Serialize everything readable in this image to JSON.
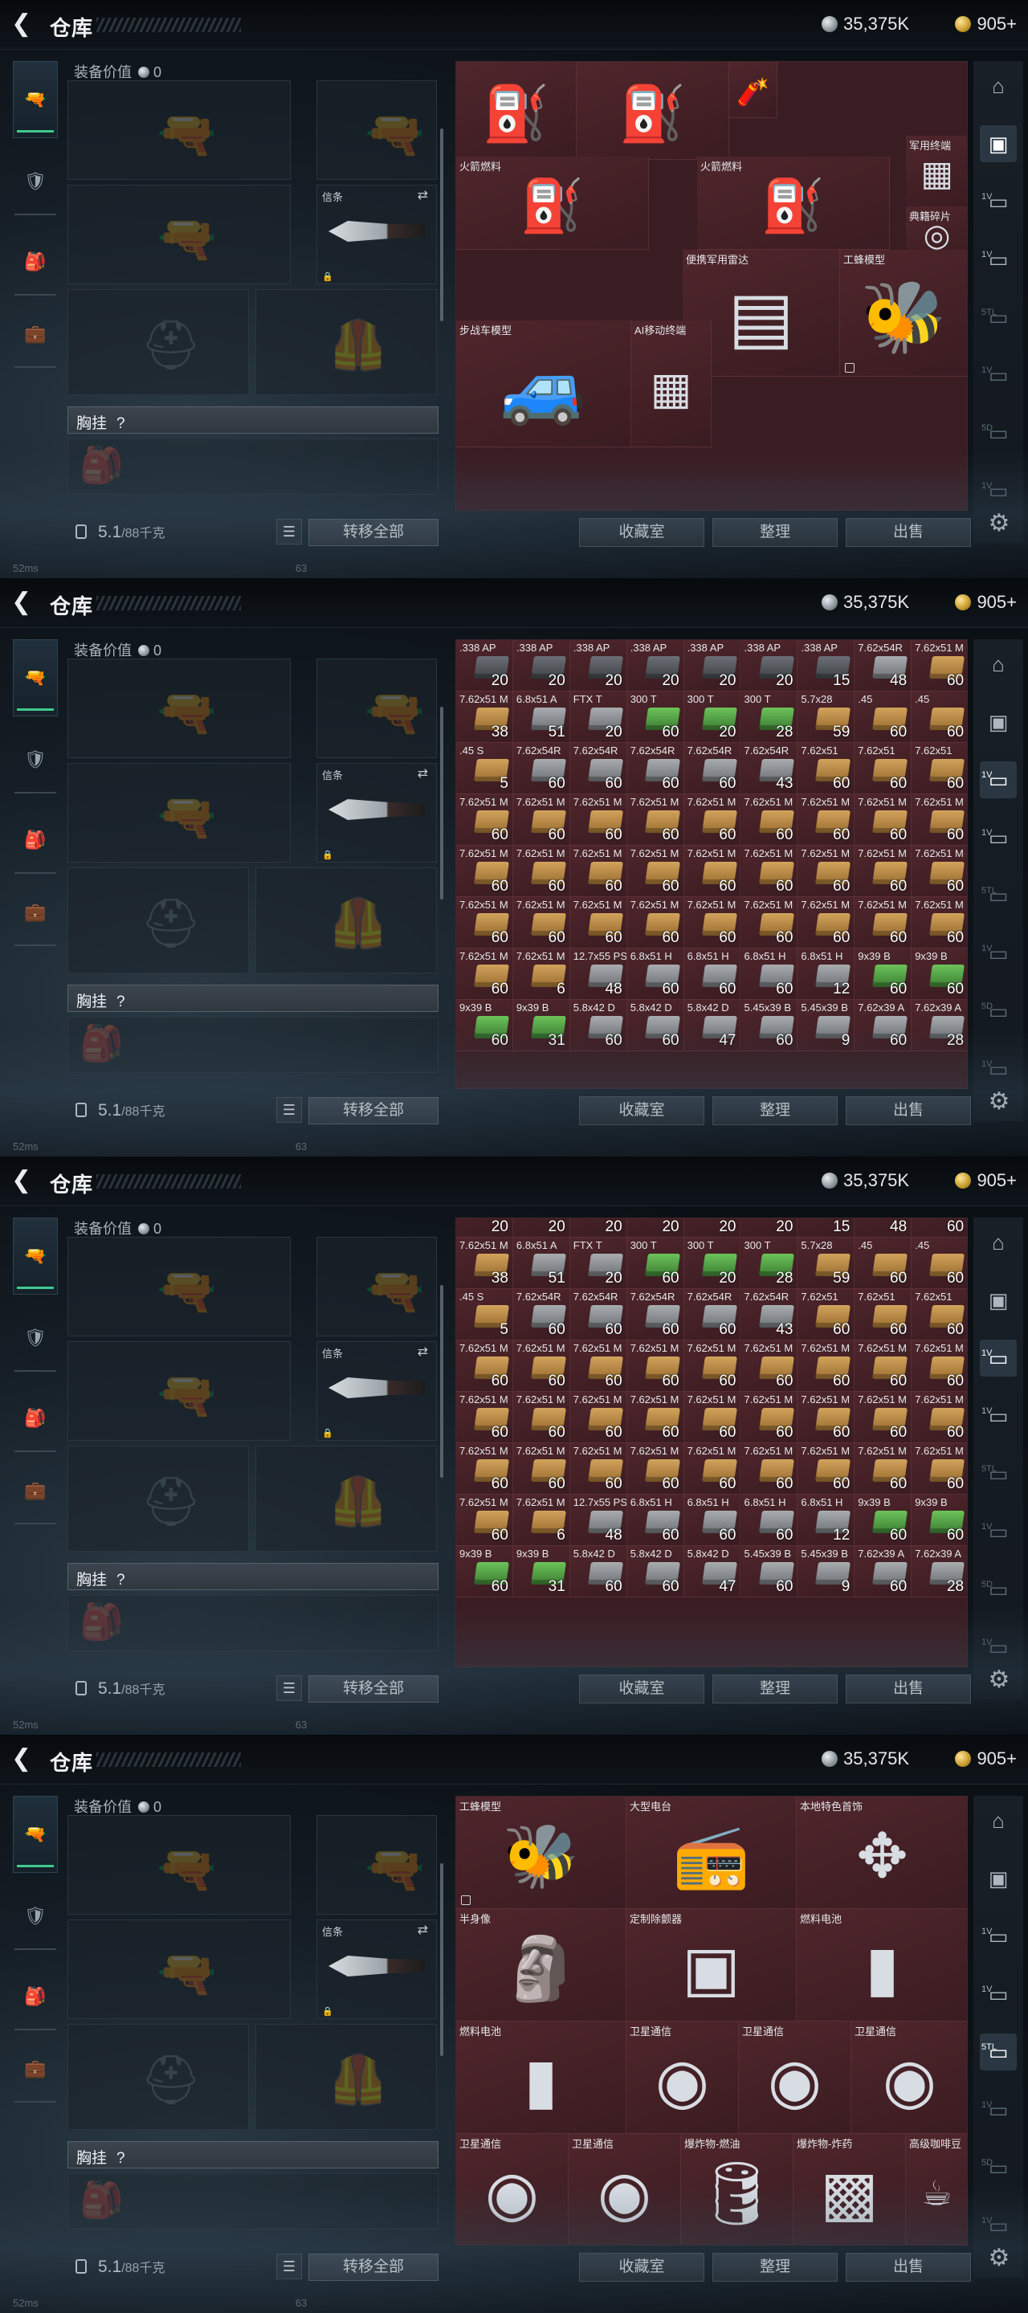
{
  "app": {
    "title": "仓库",
    "back_icon": "back-arrow-icon",
    "currency": [
      {
        "icon": "silver-coin-icon",
        "value": "35,375K"
      },
      {
        "icon": "gold-coin-icon",
        "value": "905+"
      }
    ]
  },
  "left_nav": [
    {
      "icon": "pistol-icon",
      "active": true
    },
    {
      "icon": "armor-vest-icon",
      "active": false
    },
    {
      "icon": "backpack-icon",
      "active": false
    },
    {
      "icon": "briefcase-icon",
      "active": false
    }
  ],
  "equipment": {
    "label": "装备价值",
    "value": "0",
    "melee_label": "信条",
    "chest_label": "胸挂",
    "chest_help": "?",
    "weight": "5.1",
    "weight_max": "/88千克",
    "transfer_all": "转移全部"
  },
  "actions": [
    "收藏室",
    "整理",
    "出售"
  ],
  "status": {
    "wifi": "52ms",
    "num": "63"
  },
  "right_rail": [
    {
      "icon": "vault-icon",
      "label": ""
    },
    {
      "icon": "wallet-icon",
      "label": ""
    },
    {
      "icon": "shelf-icon",
      "label": "1V"
    },
    {
      "icon": "shelf-icon",
      "label": "1V"
    },
    {
      "icon": "shelf-icon",
      "label": "5TL"
    },
    {
      "icon": "shelf-icon",
      "label": "1V"
    },
    {
      "icon": "shelf-icon",
      "label": "5D"
    },
    {
      "icon": "shelf-icon",
      "label": "1V"
    }
  ],
  "frames": [
    {
      "rail_selected": 1,
      "items": [
        {
          "name": "",
          "count": "",
          "icon": "oxygen-tank-icon"
        },
        {
          "name": "",
          "count": "",
          "icon": "oxygen-tank-icon"
        },
        {
          "name": "",
          "count": "",
          "icon": "flare-icon"
        },
        {
          "name": "火箭燃料",
          "count": "",
          "icon": "jerrycan-icon"
        },
        {
          "name": "军用终端",
          "count": "",
          "icon": "circuit-board-icon"
        },
        {
          "name": "火箭燃料",
          "count": "",
          "icon": "jerrycan-icon"
        },
        {
          "name": "典籍碎片",
          "count": "",
          "icon": "medal-icon"
        },
        {
          "name": "便携军用雷达",
          "count": "",
          "icon": "radar-icon"
        },
        {
          "name": "工蜂模型",
          "count": "",
          "icon": "bee-model-icon"
        },
        {
          "name": "步战车模型",
          "count": "",
          "icon": "ifv-model-icon"
        },
        {
          "name": "AI移动终端",
          "count": "",
          "icon": "circuit-board-icon"
        }
      ]
    },
    {
      "rail_selected": 2,
      "ammo_rows": [
        [
          [
            ".338 AP",
            "20",
            "dark"
          ],
          [
            ".338 AP",
            "20",
            "dark"
          ],
          [
            ".338 AP",
            "20",
            "dark"
          ],
          [
            ".338 AP",
            "20",
            "dark"
          ],
          [
            ".338 AP",
            "20",
            "dark"
          ],
          [
            ".338 AP",
            "20",
            "dark"
          ],
          [
            ".338 AP",
            "15",
            "dark"
          ],
          [
            "7.62x54R",
            "48",
            "grey"
          ],
          [
            "7.62x51 M",
            "60",
            "tan"
          ]
        ],
        [
          [
            "7.62x51 M",
            "38",
            "tan"
          ],
          [
            "6.8x51 A",
            "51",
            "grey"
          ],
          [
            "FTX T",
            "20",
            "grey"
          ],
          [
            "300 T",
            "60",
            "green"
          ],
          [
            "300 T",
            "20",
            "green"
          ],
          [
            "300 T",
            "28",
            "green"
          ],
          [
            "5.7x28",
            "59",
            "tan"
          ],
          [
            ".45",
            "60",
            "tan"
          ],
          [
            ".45",
            "60",
            "tan"
          ]
        ],
        [
          [
            ".45 S",
            "5",
            "tan"
          ],
          [
            "7.62x54R",
            "60",
            "grey"
          ],
          [
            "7.62x54R",
            "60",
            "grey"
          ],
          [
            "7.62x54R",
            "60",
            "grey"
          ],
          [
            "7.62x54R",
            "60",
            "grey"
          ],
          [
            "7.62x54R",
            "43",
            "grey"
          ],
          [
            "7.62x51",
            "60",
            "tan"
          ],
          [
            "7.62x51",
            "60",
            "tan"
          ],
          [
            "7.62x51",
            "60",
            "tan"
          ]
        ],
        [
          [
            "7.62x51 M",
            "60",
            "tan"
          ],
          [
            "7.62x51 M",
            "60",
            "tan"
          ],
          [
            "7.62x51 M",
            "60",
            "tan"
          ],
          [
            "7.62x51 M",
            "60",
            "tan"
          ],
          [
            "7.62x51 M",
            "60",
            "tan"
          ],
          [
            "7.62x51 M",
            "60",
            "tan"
          ],
          [
            "7.62x51 M",
            "60",
            "tan"
          ],
          [
            "7.62x51 M",
            "60",
            "tan"
          ],
          [
            "7.62x51 M",
            "60",
            "tan"
          ]
        ],
        [
          [
            "7.62x51 M",
            "60",
            "tan"
          ],
          [
            "7.62x51 M",
            "60",
            "tan"
          ],
          [
            "7.62x51 M",
            "60",
            "tan"
          ],
          [
            "7.62x51 M",
            "60",
            "tan"
          ],
          [
            "7.62x51 M",
            "60",
            "tan"
          ],
          [
            "7.62x51 M",
            "60",
            "tan"
          ],
          [
            "7.62x51 M",
            "60",
            "tan"
          ],
          [
            "7.62x51 M",
            "60",
            "tan"
          ],
          [
            "7.62x51 M",
            "60",
            "tan"
          ]
        ],
        [
          [
            "7.62x51 M",
            "60",
            "tan"
          ],
          [
            "7.62x51 M",
            "60",
            "tan"
          ],
          [
            "7.62x51 M",
            "60",
            "tan"
          ],
          [
            "7.62x51 M",
            "60",
            "tan"
          ],
          [
            "7.62x51 M",
            "60",
            "tan"
          ],
          [
            "7.62x51 M",
            "60",
            "tan"
          ],
          [
            "7.62x51 M",
            "60",
            "tan"
          ],
          [
            "7.62x51 M",
            "60",
            "tan"
          ],
          [
            "7.62x51 M",
            "60",
            "tan"
          ]
        ],
        [
          [
            "7.62x51 M",
            "60",
            "tan"
          ],
          [
            "7.62x51 M",
            "6",
            "tan"
          ],
          [
            "12.7x55 PS",
            "48",
            "grey"
          ],
          [
            "6.8x51 H",
            "60",
            "grey"
          ],
          [
            "6.8x51 H",
            "60",
            "grey"
          ],
          [
            "6.8x51 H",
            "60",
            "grey"
          ],
          [
            "6.8x51 H",
            "12",
            "grey"
          ],
          [
            "9x39 B",
            "60",
            "green"
          ],
          [
            "9x39 B",
            "60",
            "green"
          ]
        ],
        [
          [
            "9x39 B",
            "60",
            "green"
          ],
          [
            "9x39 B",
            "31",
            "green"
          ],
          [
            "5.8x42 D",
            "60",
            "grey"
          ],
          [
            "5.8x42 D",
            "60",
            "grey"
          ],
          [
            "5.8x42 D",
            "47",
            "grey"
          ],
          [
            "5.45x39 B",
            "60",
            "grey"
          ],
          [
            "5.45x39 B",
            "9",
            "grey"
          ],
          [
            "7.62x39 A",
            "60",
            "grey"
          ],
          [
            "7.62x39 A",
            "28",
            "grey"
          ]
        ]
      ]
    },
    {
      "rail_selected": 2,
      "partial_counts": [
        "20",
        "20",
        "20",
        "20",
        "20",
        "20",
        "15",
        "48",
        "60"
      ],
      "ammo_rows": [
        [
          [
            "7.62x51 M",
            "38",
            "tan"
          ],
          [
            "6.8x51 A",
            "51",
            "grey"
          ],
          [
            "FTX T",
            "20",
            "grey"
          ],
          [
            "300 T",
            "60",
            "green"
          ],
          [
            "300 T",
            "20",
            "green"
          ],
          [
            "300 T",
            "28",
            "green"
          ],
          [
            "5.7x28",
            "59",
            "tan"
          ],
          [
            ".45",
            "60",
            "tan"
          ],
          [
            ".45",
            "60",
            "tan"
          ]
        ],
        [
          [
            ".45 S",
            "5",
            "tan"
          ],
          [
            "7.62x54R",
            "60",
            "grey"
          ],
          [
            "7.62x54R",
            "60",
            "grey"
          ],
          [
            "7.62x54R",
            "60",
            "grey"
          ],
          [
            "7.62x54R",
            "60",
            "grey"
          ],
          [
            "7.62x54R",
            "43",
            "grey"
          ],
          [
            "7.62x51",
            "60",
            "tan"
          ],
          [
            "7.62x51",
            "60",
            "tan"
          ],
          [
            "7.62x51",
            "60",
            "tan"
          ]
        ],
        [
          [
            "7.62x51 M",
            "60",
            "tan"
          ],
          [
            "7.62x51 M",
            "60",
            "tan"
          ],
          [
            "7.62x51 M",
            "60",
            "tan"
          ],
          [
            "7.62x51 M",
            "60",
            "tan"
          ],
          [
            "7.62x51 M",
            "60",
            "tan"
          ],
          [
            "7.62x51 M",
            "60",
            "tan"
          ],
          [
            "7.62x51 M",
            "60",
            "tan"
          ],
          [
            "7.62x51 M",
            "60",
            "tan"
          ],
          [
            "7.62x51 M",
            "60",
            "tan"
          ]
        ],
        [
          [
            "7.62x51 M",
            "60",
            "tan"
          ],
          [
            "7.62x51 M",
            "60",
            "tan"
          ],
          [
            "7.62x51 M",
            "60",
            "tan"
          ],
          [
            "7.62x51 M",
            "60",
            "tan"
          ],
          [
            "7.62x51 M",
            "60",
            "tan"
          ],
          [
            "7.62x51 M",
            "60",
            "tan"
          ],
          [
            "7.62x51 M",
            "60",
            "tan"
          ],
          [
            "7.62x51 M",
            "60",
            "tan"
          ],
          [
            "7.62x51 M",
            "60",
            "tan"
          ]
        ],
        [
          [
            "7.62x51 M",
            "60",
            "tan"
          ],
          [
            "7.62x51 M",
            "60",
            "tan"
          ],
          [
            "7.62x51 M",
            "60",
            "tan"
          ],
          [
            "7.62x51 M",
            "60",
            "tan"
          ],
          [
            "7.62x51 M",
            "60",
            "tan"
          ],
          [
            "7.62x51 M",
            "60",
            "tan"
          ],
          [
            "7.62x51 M",
            "60",
            "tan"
          ],
          [
            "7.62x51 M",
            "60",
            "tan"
          ],
          [
            "7.62x51 M",
            "60",
            "tan"
          ]
        ],
        [
          [
            "7.62x51 M",
            "60",
            "tan"
          ],
          [
            "7.62x51 M",
            "6",
            "tan"
          ],
          [
            "12.7x55 PS",
            "48",
            "grey"
          ],
          [
            "6.8x51 H",
            "60",
            "grey"
          ],
          [
            "6.8x51 H",
            "60",
            "grey"
          ],
          [
            "6.8x51 H",
            "60",
            "grey"
          ],
          [
            "6.8x51 H",
            "12",
            "grey"
          ],
          [
            "9x39 B",
            "60",
            "green"
          ],
          [
            "9x39 B",
            "60",
            "green"
          ]
        ],
        [
          [
            "9x39 B",
            "60",
            "green"
          ],
          [
            "9x39 B",
            "31",
            "green"
          ],
          [
            "5.8x42 D",
            "60",
            "grey"
          ],
          [
            "5.8x42 D",
            "60",
            "grey"
          ],
          [
            "5.8x42 D",
            "47",
            "grey"
          ],
          [
            "5.45x39 B",
            "60",
            "grey"
          ],
          [
            "5.45x39 B",
            "9",
            "grey"
          ],
          [
            "7.62x39 A",
            "60",
            "grey"
          ],
          [
            "7.62x39 A",
            "28",
            "grey"
          ]
        ]
      ]
    },
    {
      "rail_selected": 4,
      "items": [
        {
          "name": "工蜂模型",
          "count": "",
          "icon": "bee-model-icon"
        },
        {
          "name": "大型电台",
          "count": "",
          "icon": "radio-station-icon"
        },
        {
          "name": "本地特色首饰",
          "count": "",
          "icon": "jewelry-icon"
        },
        {
          "name": "半身像",
          "count": "",
          "icon": "bust-statue-icon"
        },
        {
          "name": "定制除颤器",
          "count": "",
          "icon": "defibrillator-icon"
        },
        {
          "name": "燃料电池",
          "count": "",
          "icon": "fuel-cell-icon"
        },
        {
          "name": "燃料电池",
          "count": "",
          "icon": "fuel-cell-icon"
        },
        {
          "name": "卫星通信",
          "count": "",
          "icon": "satellite-dish-icon"
        },
        {
          "name": "卫星通信",
          "count": "",
          "icon": "satellite-dish-icon"
        },
        {
          "name": "卫星通信",
          "count": "",
          "icon": "satellite-dish-icon"
        },
        {
          "name": "卫星通信",
          "count": "",
          "icon": "satellite-dish-icon"
        },
        {
          "name": "卫星通信",
          "count": "",
          "icon": "satellite-dish-icon"
        },
        {
          "name": "爆炸物-燃油",
          "count": "",
          "icon": "oil-canister-icon"
        },
        {
          "name": "爆炸物-炸药",
          "count": "",
          "icon": "explosive-crate-icon"
        },
        {
          "name": "高级咖啡豆",
          "count": "",
          "icon": "coffee-bag-icon"
        }
      ]
    }
  ]
}
